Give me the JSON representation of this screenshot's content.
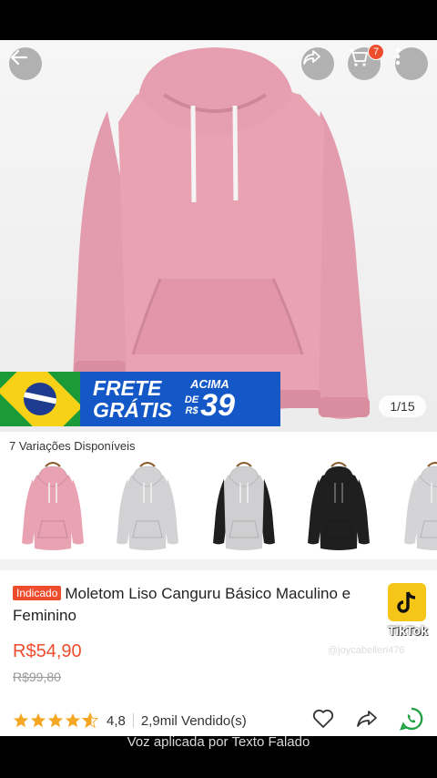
{
  "header": {
    "cart_count": "7"
  },
  "hero": {
    "image_counter": "1/15"
  },
  "banner": {
    "frete_line1": "FRETE",
    "frete_line2": "GRÁTIS",
    "acima": "ACIMA",
    "de": "DE",
    "currency": "R$",
    "amount": "39"
  },
  "variations": {
    "label": "7 Variações Disponíveis",
    "items": [
      {
        "color": "pink",
        "body": "#e9a2b2"
      },
      {
        "color": "light-grey",
        "body": "#d2d2d4"
      },
      {
        "color": "grey-black-sleeves",
        "body": "#cfcfd1"
      },
      {
        "color": "black",
        "body": "#1f1f1f"
      },
      {
        "color": "light-grey-2",
        "body": "#d4d4d6"
      }
    ]
  },
  "product": {
    "tag": "Indicado",
    "title": "Moletom Liso Canguru Básico Maculino e Feminino",
    "price": "R$54,90",
    "old_price": "R$99,80",
    "rating": "4,8",
    "sold": "2,9mil Vendido(s)"
  },
  "overlay": {
    "tiktok_label": "TikTok",
    "tiktok_user": "@joycabelleri476",
    "caption": "Voz aplicada por Texto Falado"
  },
  "colors": {
    "accent": "#ee4d2d",
    "banner_blue": "#1458c8",
    "hoodie_pink": "#e9a2b2"
  }
}
